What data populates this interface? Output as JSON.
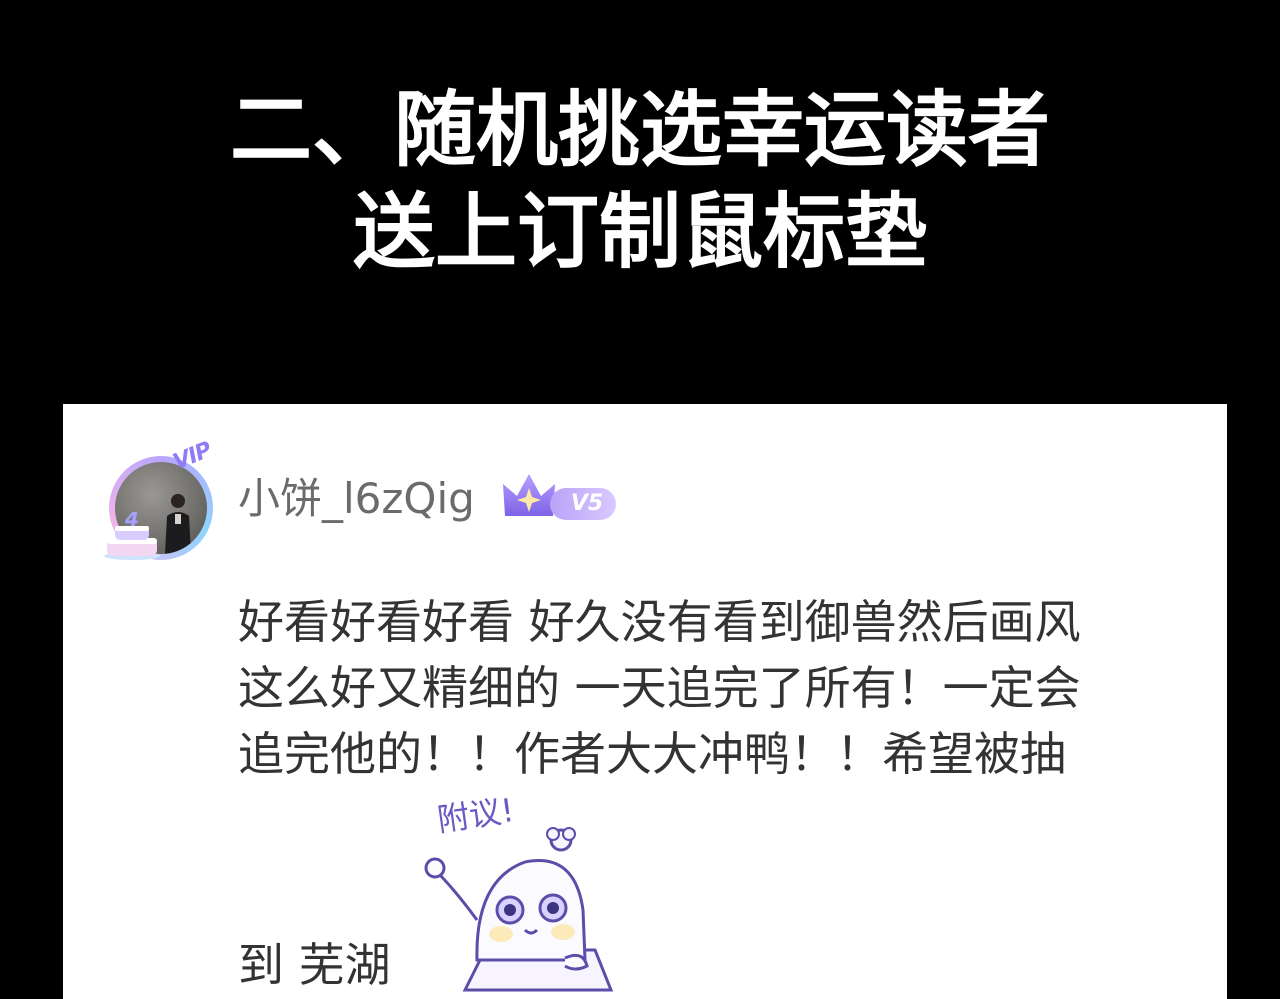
{
  "headline": {
    "line1": "二、随机挑选幸运读者",
    "line2": "送上订制鼠标垫"
  },
  "comment_card": {
    "avatar_vip_tag": "VIP",
    "avatar_badge_number": "4",
    "username": "小饼_l6zQig",
    "level_badge": "V5",
    "body_lines": [
      "好看好看好看 好久没有看到御兽然后画风",
      "这么好又精细的 一天追完了所有！一定会",
      "追完他的！！作者大大冲鸭！！希望被抽"
    ],
    "sticker_caption": "附议!",
    "trailing_text": "到 芜湖"
  },
  "colors": {
    "page_background": "#000000",
    "headline_text": "#ffffff",
    "card_background": "#ffffff",
    "username_text": "#6b6b6b",
    "comment_text": "#333333",
    "accent_purple": "#8e7cf5"
  }
}
